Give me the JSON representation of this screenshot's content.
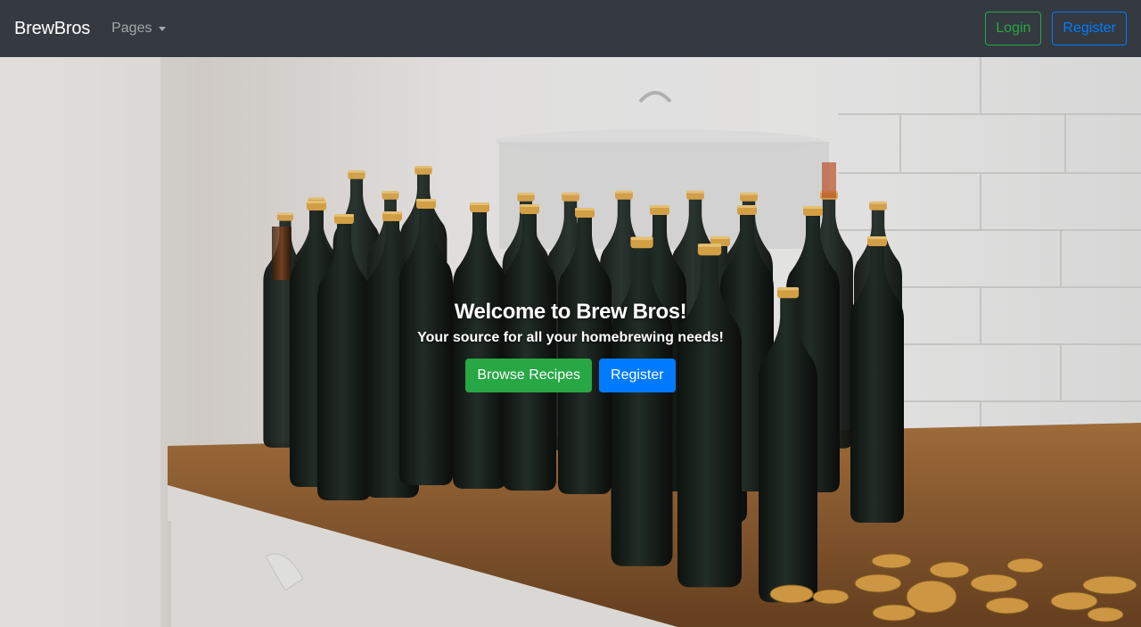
{
  "navbar": {
    "brand": "BrewBros",
    "dropdown_label": "Pages",
    "login_label": "Login",
    "register_label": "Register"
  },
  "hero": {
    "title": "Welcome to Brew Bros!",
    "subtitle": "Your source for all your homebrewing needs!",
    "browse_label": "Browse Recipes",
    "register_label": "Register",
    "background_image": "amber beer bottles with gold caps on wooden counter"
  },
  "colors": {
    "navbar_bg": "#343a40",
    "success": "#28a745",
    "primary": "#007bff"
  }
}
